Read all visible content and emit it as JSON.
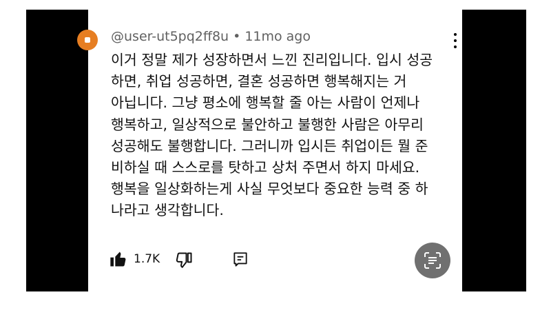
{
  "comment": {
    "author": "@user-ut5pq2ff8u",
    "separator": "•",
    "time": "11mo ago",
    "lines": [
      "이거 정말 제가 성장하면서 느낀 진리입니다. 입시 성공",
      "하면, 취업 성공하면, 결혼 성공하면 행복해지는 거",
      "아닙니다. 그냥 평소에 행복할 줄 아는 사람이 언제나",
      "행복하고, 일상적으로 불안하고 불행한 사람은 아무리",
      "성공해도 불행합니다. 그러니까 입시든 취업이든 뭘 준",
      "비하실 때 스스로를 탓하고 상처 주면서 하지 마세요.",
      "행복을 일상화하는게 사실 무엇보다 중요한 능력 중 하",
      "나라고 생각합니다."
    ],
    "like_count": "1.7K"
  },
  "icons": {
    "avatar": "avatar",
    "more": "more-vertical-icon",
    "like": "thumbs-up-icon",
    "dislike": "thumbs-down-icon",
    "reply": "reply-icon",
    "lens": "lens-scan-icon"
  },
  "colors": {
    "avatar": "#e67e22",
    "meta_text": "#606060",
    "body_text": "#111111",
    "lens_button": "#707070"
  }
}
